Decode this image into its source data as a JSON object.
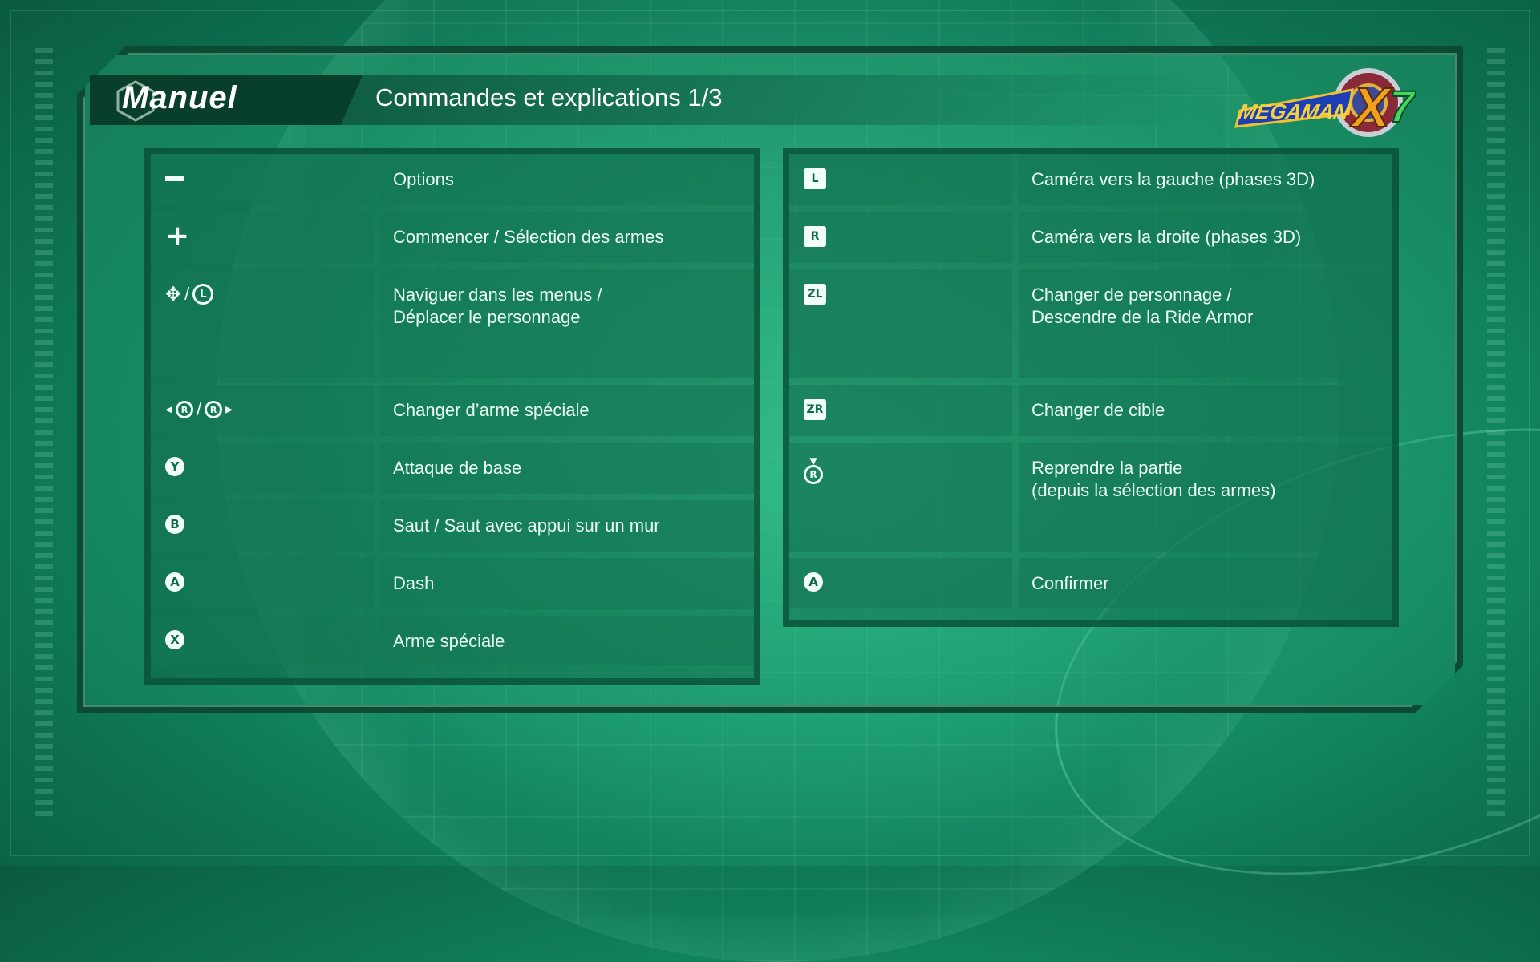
{
  "header": {
    "section": "Manuel",
    "title": "Commandes et explications 1/3",
    "logo_text": "MEGAMAN X7"
  },
  "left_table": [
    {
      "icon": "minus-button-icon",
      "label": "Options"
    },
    {
      "icon": "plus-button-icon",
      "label": "Commencer / Sélection des armes"
    },
    {
      "icon": "dpad-and-left-stick-icon",
      "label": "Naviguer dans les menus /\nDéplacer le personnage"
    },
    {
      "icon": "right-stick-left-right-icon",
      "label": "Changer d’arme spéciale"
    },
    {
      "icon": "y-button-icon",
      "glyph": "Y",
      "label": "Attaque de base"
    },
    {
      "icon": "b-button-icon",
      "glyph": "B",
      "label": "Saut / Saut avec appui sur un mur"
    },
    {
      "icon": "a-button-icon",
      "glyph": "A",
      "label": "Dash"
    },
    {
      "icon": "x-button-icon",
      "glyph": "X",
      "label": "Arme spéciale"
    }
  ],
  "right_table": [
    {
      "icon": "l-button-icon",
      "glyph": "L",
      "label": "Caméra vers la gauche (phases 3D)"
    },
    {
      "icon": "r-button-icon",
      "glyph": "R",
      "label": "Caméra vers la droite (phases 3D)"
    },
    {
      "icon": "zl-button-icon",
      "glyph": "ZL",
      "label": "Changer de personnage /\nDescendre de la Ride Armor"
    },
    {
      "icon": "zr-button-icon",
      "glyph": "ZR",
      "label": "Changer de cible"
    },
    {
      "icon": "right-stick-press-icon",
      "label": "Reprendre la partie\n(depuis la sélection des armes)"
    },
    {
      "icon": "a-button-icon",
      "glyph": "A",
      "label": "Confirmer"
    }
  ],
  "colors": {
    "accent": "#1a9a6f",
    "panel_border": "#0d4a34",
    "text": "#eafff4"
  }
}
